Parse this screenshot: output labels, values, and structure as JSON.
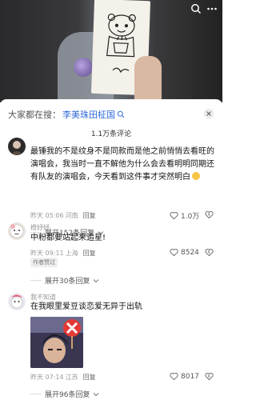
{
  "search_bar": {
    "prefix": "大家都在搜：",
    "keyword": "李美珠田柾国"
  },
  "comment_count": "1.1万条评论",
  "comments": [
    {
      "user": "",
      "text": "最锤我的不是纹身不是同款而是他之前悄悄去看旺的演唱会，我当时一直不解他为什么会去看明明同期还有队友的演唱会，今天看到这件事才突然明白",
      "time": "昨天 05:06",
      "location": "河南",
      "reply": "回复",
      "likes": "1.0万",
      "expand": "展开152条回复"
    },
    {
      "user": "橙妤妤",
      "text": "中粉都要站起来追星!",
      "time": "昨天 09:11",
      "location": "上海",
      "reply": "回复",
      "likes": "8524",
      "tag": "作者赞过",
      "expand": "展开30条回复"
    },
    {
      "user": "我不知道",
      "text": "在我眼里爱豆谈恋爱无异于出轨",
      "time": "昨天 07:14",
      "location": "江苏",
      "reply": "回复",
      "likes": "8017",
      "expand": "展开96条回复"
    }
  ]
}
